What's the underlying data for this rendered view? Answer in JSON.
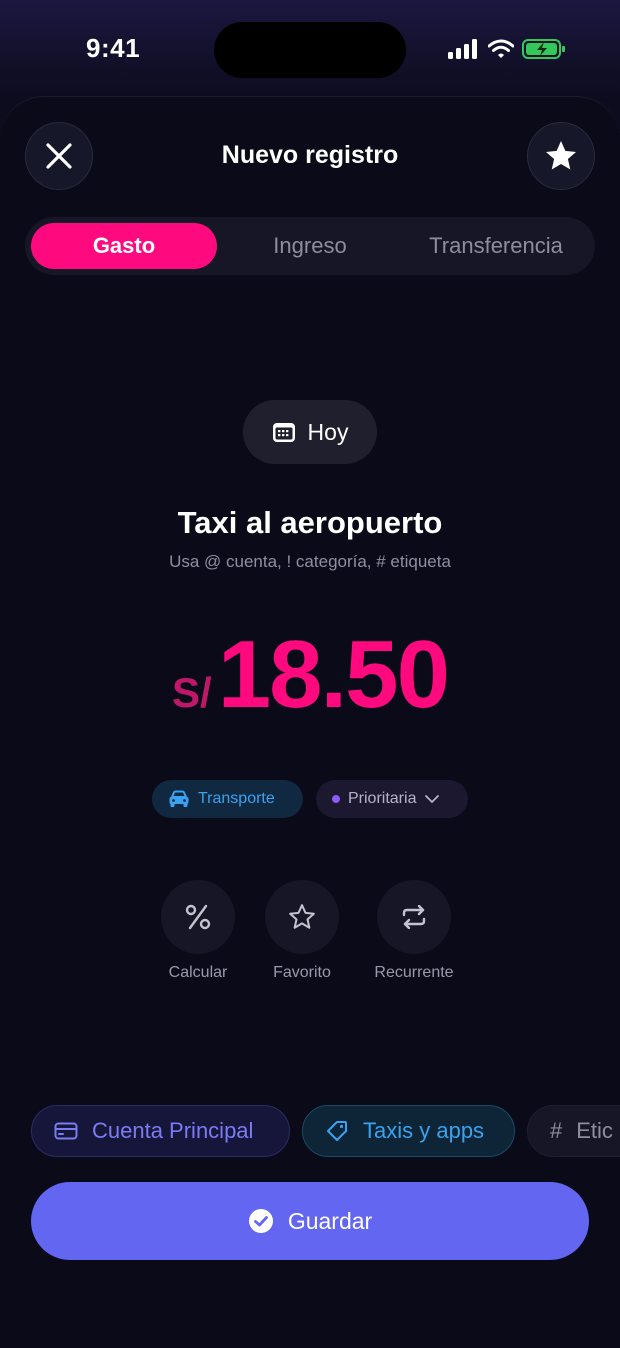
{
  "status_bar": {
    "time": "9:41"
  },
  "header": {
    "title": "Nuevo registro",
    "close_icon": "close-icon",
    "star_icon": "star-icon"
  },
  "tabs": [
    {
      "label": "Gasto",
      "active": true
    },
    {
      "label": "Ingreso",
      "active": false
    },
    {
      "label": "Transferencia",
      "active": false
    }
  ],
  "date": {
    "label": "Hoy",
    "icon": "calendar-icon"
  },
  "entry": {
    "description": "Taxi al aeropuerto",
    "hint": "Usa @ cuenta, ! categoría, # etiqueta",
    "currency": "S/",
    "amount": "18.50"
  },
  "chips": {
    "category": {
      "label": "Transporte",
      "icon": "car-icon"
    },
    "priority": {
      "label": "Prioritaria",
      "icon": "chevron-down-icon"
    }
  },
  "actions": [
    {
      "label": "Calcular",
      "icon": "percent-icon"
    },
    {
      "label": "Favorito",
      "icon": "star-outline-icon"
    },
    {
      "label": "Recurrente",
      "icon": "repeat-icon"
    }
  ],
  "bottom_chips": {
    "account": "Cuenta Principal",
    "tags": "Taxis y apps",
    "label": "Etic"
  },
  "save_button": {
    "label": "Guardar"
  },
  "colors": {
    "accent": "#ff0a7e",
    "primary": "#6366f1",
    "transport": "#3aa2f0"
  }
}
